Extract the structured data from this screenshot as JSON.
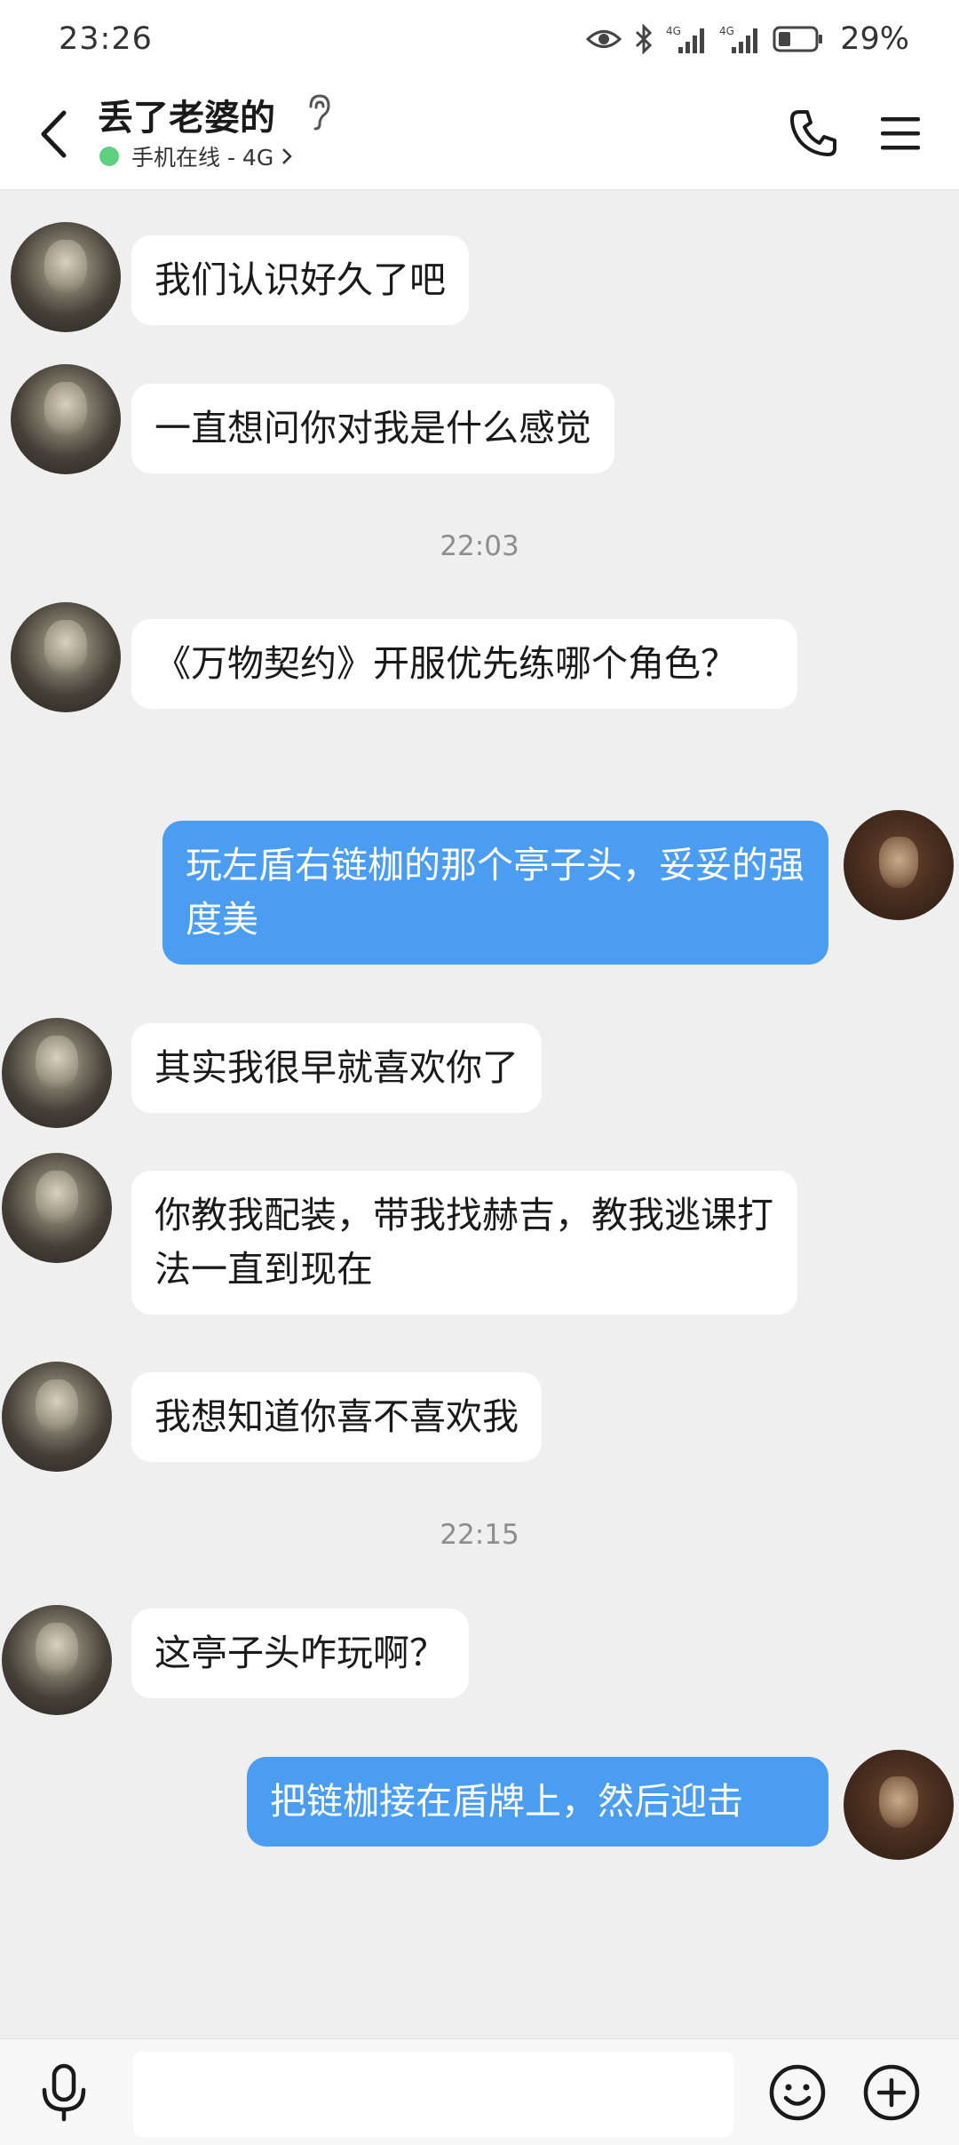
{
  "status_bar": {
    "time": "23:26",
    "battery": "29%"
  },
  "header": {
    "contact_name": "丢了老婆的",
    "presence": "手机在线 - 4G"
  },
  "messages": [
    {
      "side": "in",
      "text": "我们认识好久了吧"
    },
    {
      "side": "in",
      "text": "一直想问你对我是什么感觉"
    },
    {
      "type": "time",
      "text": "22:03"
    },
    {
      "side": "in",
      "text": "《万物契约》开服优先练哪个角色？"
    },
    {
      "side": "out",
      "text": "玩左盾右链枷的那个亭子头，妥妥的强度美"
    },
    {
      "side": "in",
      "text": "其实我很早就喜欢你了"
    },
    {
      "side": "in",
      "text": "你教我配装，带我找赫吉，教我逃课打法一直到现在"
    },
    {
      "side": "in",
      "text": "我想知道你喜不喜欢我"
    },
    {
      "type": "time",
      "text": "22:15"
    },
    {
      "side": "in",
      "text": "这亭子头咋玩啊？"
    },
    {
      "side": "out",
      "text": "把链枷接在盾牌上，然后迎击"
    }
  ],
  "input": {
    "value": "",
    "placeholder": ""
  },
  "icons": {
    "back": "back-arrow-icon",
    "ear": "ear-icon",
    "call": "phone-icon",
    "menu": "menu-icon",
    "mic": "microphone-icon",
    "emoji": "emoji-icon",
    "plus": "plus-icon"
  },
  "colors": {
    "outgoing_bubble": "#4b9df2",
    "incoming_bubble": "#ffffff",
    "online_dot": "#5ed080",
    "background": "#efefef"
  }
}
